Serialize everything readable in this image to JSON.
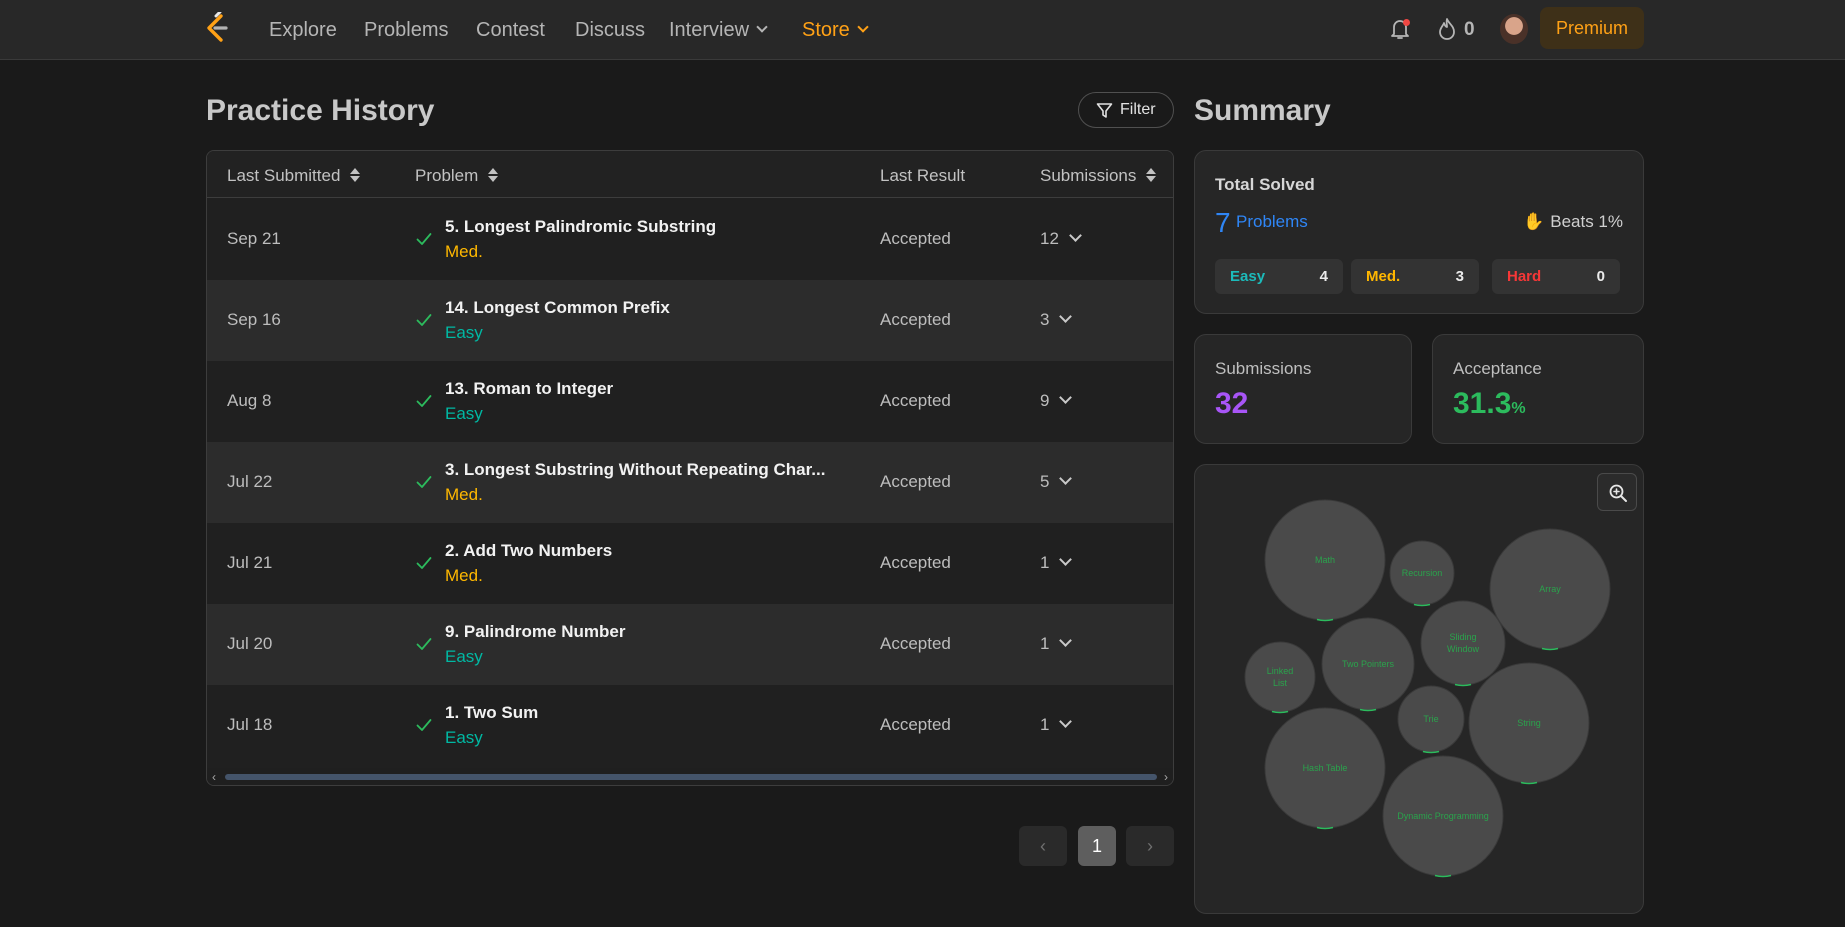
{
  "nav": {
    "links": [
      "Explore",
      "Problems",
      "Contest",
      "Discuss"
    ],
    "interview_label": "Interview",
    "store_label": "Store",
    "streak": "0",
    "premium_label": "Premium"
  },
  "history": {
    "title": "Practice History",
    "filter_label": "Filter",
    "columns": [
      "Last Submitted",
      "Problem",
      "Last Result",
      "Submissions"
    ],
    "rows": [
      {
        "date": "Sep 21",
        "title": "5. Longest Palindromic Substring",
        "difficulty": "Med.",
        "result": "Accepted",
        "submissions": "12"
      },
      {
        "date": "Sep 16",
        "title": "14. Longest Common Prefix",
        "difficulty": "Easy",
        "result": "Accepted",
        "submissions": "3"
      },
      {
        "date": "Aug 8",
        "title": "13. Roman to Integer",
        "difficulty": "Easy",
        "result": "Accepted",
        "submissions": "9"
      },
      {
        "date": "Jul 22",
        "title": "3. Longest Substring Without Repeating Char...",
        "difficulty": "Med.",
        "result": "Accepted",
        "submissions": "5"
      },
      {
        "date": "Jul 21",
        "title": "2. Add Two Numbers",
        "difficulty": "Med.",
        "result": "Accepted",
        "submissions": "1"
      },
      {
        "date": "Jul 20",
        "title": "9. Palindrome Number",
        "difficulty": "Easy",
        "result": "Accepted",
        "submissions": "1"
      },
      {
        "date": "Jul 18",
        "title": "1. Two Sum",
        "difficulty": "Easy",
        "result": "Accepted",
        "submissions": "1"
      }
    ],
    "pagination": {
      "current_page": "1",
      "prev_icon": "chevron-left-icon",
      "next_icon": "chevron-right-icon"
    }
  },
  "summary": {
    "title": "Summary",
    "total_solved_label": "Total Solved",
    "solved_count": "7",
    "solved_unit": "Problems",
    "beats_label": "Beats 1%",
    "difficulty": [
      {
        "label": "Easy",
        "count": "4",
        "color": "#1cbaba"
      },
      {
        "label": "Med.",
        "count": "3",
        "color": "#ffb700"
      },
      {
        "label": "Hard",
        "count": "0",
        "color": "#f63737"
      }
    ],
    "submissions_label": "Submissions",
    "submissions_value": "32",
    "submissions_color": "#a855f7",
    "acceptance_label": "Acceptance",
    "acceptance_value": "31.3",
    "acceptance_unit": "%",
    "acceptance_color": "#2cbb5d",
    "topics": [
      "Math",
      "Recursion",
      "Array",
      "Linked List",
      "Two Pointers",
      "Sliding Window",
      "Trie",
      "String",
      "Hash Table",
      "Dynamic Programming"
    ]
  },
  "colors": {
    "accent": "#ffa116",
    "link_blue": "#2f86f6",
    "easy": "#00b8a3",
    "medium": "#ffb800",
    "accepted_check": "#2cbb5d"
  }
}
